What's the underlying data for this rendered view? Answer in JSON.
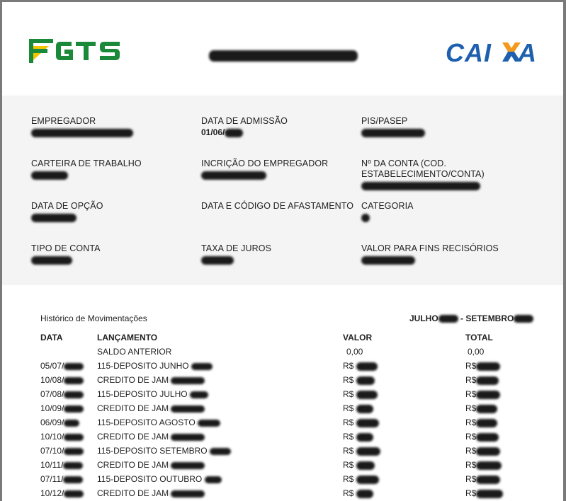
{
  "header": {
    "fgts_logo": "FGTS",
    "caixa_logo": "CAIXA"
  },
  "colors": {
    "fgts_green": "#1a8a3a",
    "fgts_yellow": "#f2c500",
    "caixa_blue": "#1e5fae",
    "caixa_orange": "#f39a1e",
    "panel_bg": "#f4f4f4"
  },
  "info": {
    "empregador_label": "EMPREGADOR",
    "data_admissao_label": "DATA DE ADMISSÃO",
    "data_admissao_value": "01/06/",
    "pis_label": "PIS/PASEP",
    "carteira_label": "CARTEIRA DE TRABALHO",
    "inscricao_label": "INCRIÇÃO DO EMPREGADOR",
    "conta_label": "Nº DA CONTA (COD. ESTABELECIMENTO/CONTA)",
    "data_opcao_label": "DATA DE OPÇÃO",
    "afastamento_label": "DATA E CÓDIGO DE AFASTAMENTO",
    "categoria_label": "CATEGORIA",
    "tipo_conta_label": "TIPO DE CONTA",
    "taxa_juros_label": "TAXA DE JUROS",
    "valor_fins_label": "VALOR PARA FINS RECISÓRIOS"
  },
  "history": {
    "title": "Histórico de Movimentações",
    "period_start": "JULHO",
    "period_sep": "- SETEMBRO",
    "columns": {
      "data": "DATA",
      "lancamento": "LANÇAMENTO",
      "valor": "VALOR",
      "total": "TOTAL"
    },
    "saldo_label": "SALDO ANTERIOR",
    "saldo_valor": "0,00",
    "saldo_total": "0,00",
    "currency": "R$",
    "rows": [
      {
        "date": "05/07/",
        "desc": "115-DEPOSITO JUNHO"
      },
      {
        "date": "10/08/",
        "desc": "CREDITO DE JAM"
      },
      {
        "date": "07/08/",
        "desc": "115-DEPOSITO JULHO"
      },
      {
        "date": "10/09/",
        "desc": "CREDITO DE JAM"
      },
      {
        "date": "06/09/",
        "desc": "115-DEPOSITO AGOSTO"
      },
      {
        "date": "10/10/",
        "desc": "CREDITO DE JAM"
      },
      {
        "date": "07/10/",
        "desc": "115-DEPOSITO SETEMBRO"
      },
      {
        "date": "10/11/",
        "desc": "CREDITO DE JAM"
      },
      {
        "date": "07/11/",
        "desc": "115-DEPOSITO OUTUBRO"
      },
      {
        "date": "10/12/",
        "desc": "CREDITO DE JAM"
      }
    ]
  }
}
